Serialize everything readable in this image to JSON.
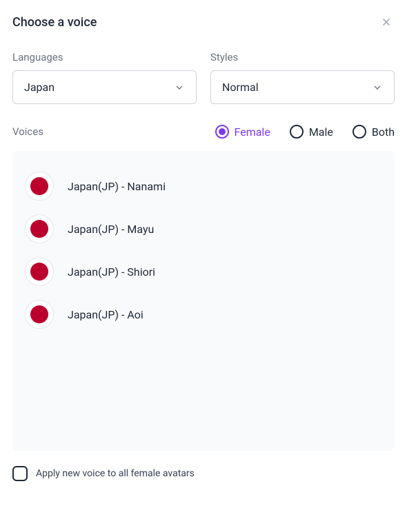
{
  "title": "Choose a voice",
  "filters": {
    "languages": {
      "label": "Languages",
      "value": "Japan"
    },
    "styles": {
      "label": "Styles",
      "value": "Normal"
    }
  },
  "voices_section": {
    "label": "Voices",
    "gender_options": {
      "female": "Female",
      "male": "Male",
      "both": "Both"
    },
    "selected_gender": "female"
  },
  "voices": [
    {
      "name": "Japan(JP) - Nanami",
      "flag_color": "#bc002d"
    },
    {
      "name": "Japan(JP) - Mayu",
      "flag_color": "#bc002d"
    },
    {
      "name": "Japan(JP) - Shiori",
      "flag_color": "#bc002d"
    },
    {
      "name": "Japan(JP) - Aoi",
      "flag_color": "#bc002d"
    }
  ],
  "apply_all": {
    "label": "Apply new voice to all female avatars",
    "checked": false
  }
}
